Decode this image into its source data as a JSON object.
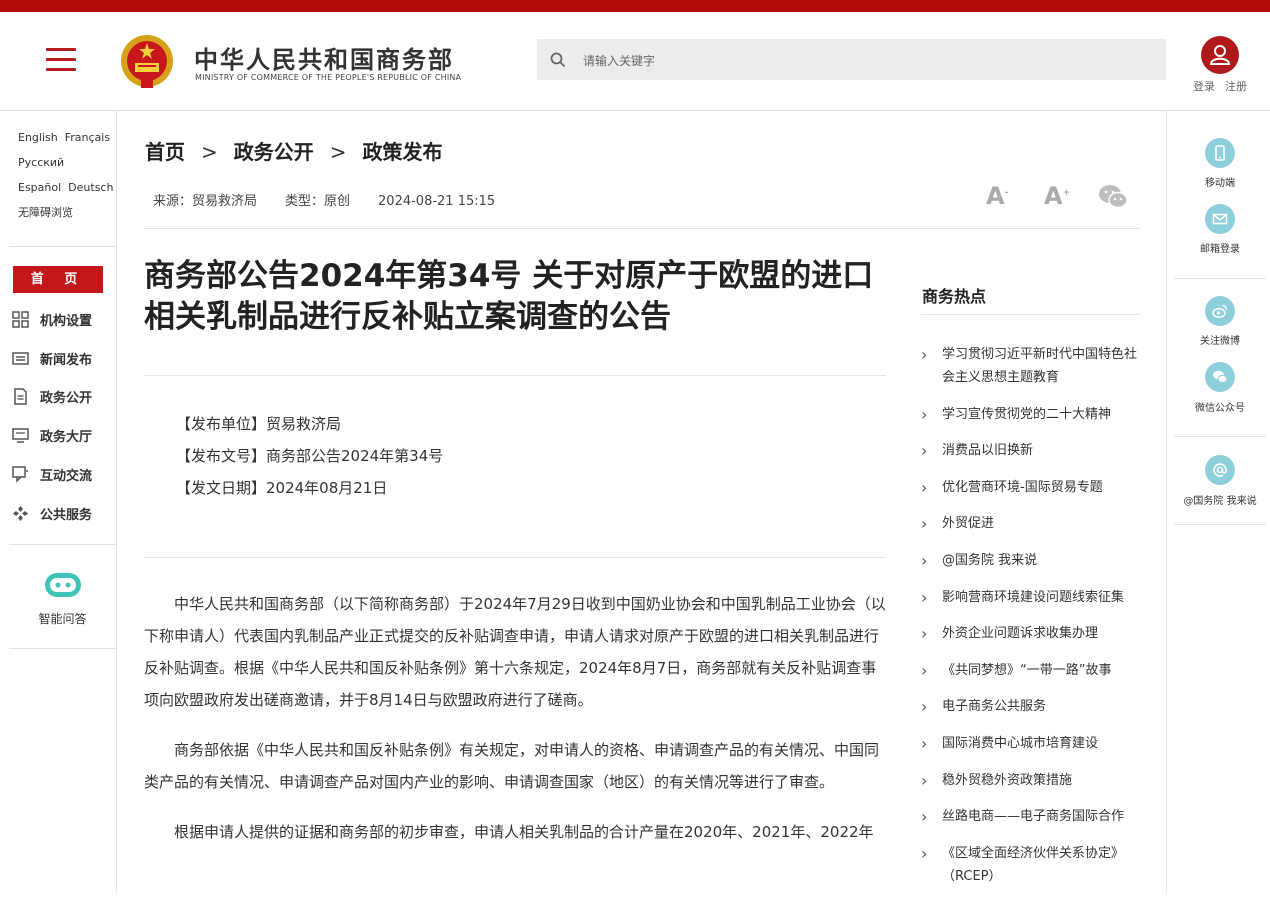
{
  "header": {
    "logo_cn": "中华人民共和国商务部",
    "logo_en": "MINISTRY OF COMMERCE OF THE PEOPLE'S REPUBLIC OF CHINA",
    "search_placeholder": "请输入关键字",
    "login": "登录",
    "register": "注册"
  },
  "left": {
    "languages": [
      "English",
      "Français",
      "Русский",
      "Español",
      "Deutsch"
    ],
    "accessibility": "无障碍浏览",
    "home": "首 页",
    "nav": [
      "机构设置",
      "新闻发布",
      "政务公开",
      "政务大厅",
      "互动交流",
      "公共服务"
    ],
    "assistant": "智能问答"
  },
  "breadcrumb": [
    "首页",
    "政务公开",
    "政策发布"
  ],
  "meta": {
    "source": "来源：贸易救济局",
    "type": "类型：原创",
    "datetime": "2024-08-21 15:15"
  },
  "font_controls": {
    "larger": "A",
    "smaller": "A"
  },
  "article": {
    "title": "商务部公告2024年第34号 关于对原产于欧盟的进口相关乳制品进行反补贴立案调查的公告",
    "issuer": "【发布单位】贸易救济局",
    "doc_no": "【发布文号】商务部公告2024年第34号",
    "date": "【发文日期】2024年08月21日",
    "paragraphs": [
      "中华人民共和国商务部（以下简称商务部）于2024年7月29日收到中国奶业协会和中国乳制品工业协会（以下称申请人）代表国内乳制品产业正式提交的反补贴调查申请，申请人请求对原产于欧盟的进口相关乳制品进行反补贴调查。根据《中华人民共和国反补贴条例》第十六条规定，2024年8月7日，商务部就有关反补贴调查事项向欧盟政府发出磋商邀请，并于8月14日与欧盟政府进行了磋商。",
      "商务部依据《中华人民共和国反补贴条例》有关规定，对申请人的资格、申请调查产品的有关情况、中国同类产品的有关情况、申请调查产品对国内产业的影响、申请调查国家（地区）的有关情况等进行了审查。",
      "根据申请人提供的证据和商务部的初步审查，申请人相关乳制品的合计产量在2020年、2021年、2022年"
    ]
  },
  "hot": {
    "title": "商务热点",
    "items": [
      "学习贯彻习近平新时代中国特色社会主义思想主题教育",
      "学习宣传贯彻党的二十大精神",
      "消费品以旧换新",
      "优化营商环境-国际贸易专题",
      "外贸促进",
      "@国务院 我来说",
      "影响营商环境建设问题线索征集",
      "外资企业问题诉求收集办理",
      "《共同梦想》“一带一路”故事",
      "电子商务公共服务",
      "国际消费中心城市培育建设",
      "稳外贸稳外资政策措施",
      "丝路电商——电子商务国际合作",
      "《区域全面经济伙伴关系协定》（RCEP）"
    ]
  },
  "right": {
    "mobile": "移动端",
    "mail": "邮箱登录",
    "weibo": "关注微博",
    "wechat": "微信公众号",
    "gwy": "@国务院 我来说"
  }
}
